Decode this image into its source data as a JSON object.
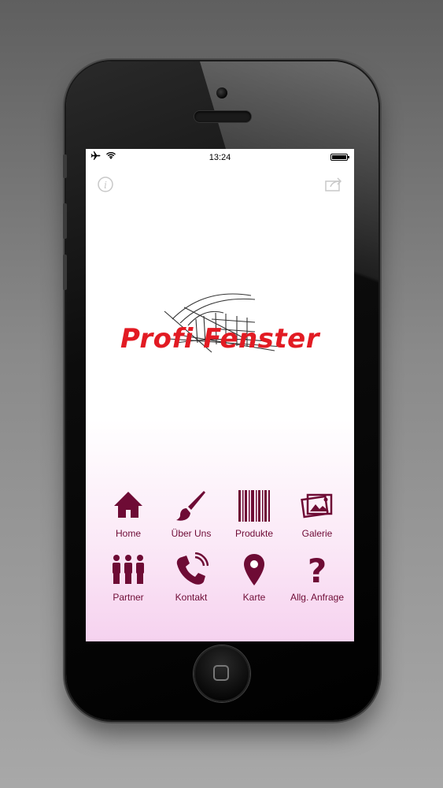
{
  "status_bar": {
    "time": "13:24"
  },
  "logo": {
    "brand": "Profi Fenster"
  },
  "menu": [
    {
      "label": "Home",
      "icon": "house-icon"
    },
    {
      "label": "Über Uns",
      "icon": "paintbrush-icon"
    },
    {
      "label": "Produkte",
      "icon": "barcode-icon"
    },
    {
      "label": "Galerie",
      "icon": "photos-icon"
    },
    {
      "label": "Partner",
      "icon": "people-icon"
    },
    {
      "label": "Kontakt",
      "icon": "phone-icon"
    },
    {
      "label": "Karte",
      "icon": "map-pin-icon"
    },
    {
      "label": "Allg. Anfrage",
      "icon": "question-icon"
    }
  ],
  "colors": {
    "accent": "#6e0b35",
    "brand_red": "#e21b23"
  }
}
